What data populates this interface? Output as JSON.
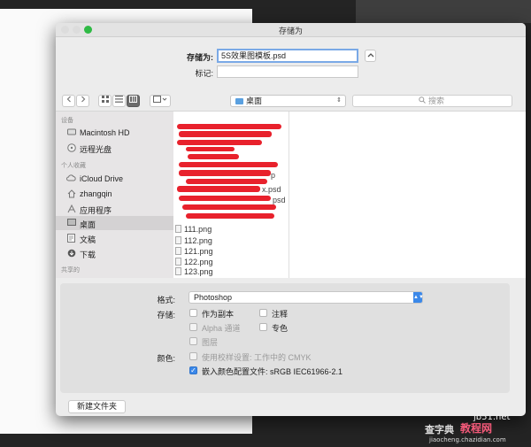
{
  "window": {
    "title": "存储为",
    "colors": {
      "close": "#dcdcdc",
      "min": "#dcdcdc",
      "zoom": "#2fba45",
      "accent": "#3b88e9",
      "redaction": "#e8212c"
    }
  },
  "header": {
    "save_as_label": "存储为:",
    "save_as_value": "5S效果图模板.psd",
    "tags_label": "标记:",
    "tags_value": "",
    "expand_icon": "chevron-up-icon"
  },
  "toolbar": {
    "back_icon": "chevron-left-icon",
    "forward_icon": "chevron-right-icon",
    "view_icons": [
      "icon-view-icon",
      "list-view-icon",
      "column-view-icon",
      "gallery-view-icon"
    ],
    "location": "桌面",
    "search_placeholder": "搜索"
  },
  "sidebar": {
    "sections": [
      {
        "heading": "设备",
        "items": [
          {
            "label": "Macintosh HD",
            "icon": "hard-drive-icon"
          },
          {
            "label": "远程光盘",
            "icon": "disc-icon"
          }
        ]
      },
      {
        "heading": "个人收藏",
        "items": [
          {
            "label": "iCloud Drive",
            "icon": "cloud-icon"
          },
          {
            "label": "zhangqin",
            "icon": "home-icon"
          },
          {
            "label": "应用程序",
            "icon": "applications-icon"
          },
          {
            "label": "桌面",
            "icon": "desktop-icon",
            "selected": true
          },
          {
            "label": "文稿",
            "icon": "document-icon"
          },
          {
            "label": "下载",
            "icon": "download-icon"
          }
        ]
      },
      {
        "heading": "共享的",
        "items": []
      }
    ]
  },
  "files": {
    "partial": [
      "p",
      "x.psd",
      "psd"
    ],
    "visible": [
      "111.png",
      "112.png",
      "121.png",
      "122.png",
      "123.png"
    ]
  },
  "options": {
    "format_label": "格式:",
    "format_value": "Photoshop",
    "save_label": "存储:",
    "color_label": "颜色:",
    "save_options": [
      {
        "label": "作为副本",
        "checked": false,
        "disabled": false
      },
      {
        "label": "注释",
        "checked": false,
        "disabled": false
      },
      {
        "label": "Alpha 通道",
        "checked": false,
        "disabled": true
      },
      {
        "label": "专色",
        "checked": false,
        "disabled": false
      },
      {
        "label": "图层",
        "checked": false,
        "disabled": true
      }
    ],
    "color_options": [
      {
        "label": "使用校样设置: 工作中的 CMYK",
        "checked": false,
        "disabled": true
      },
      {
        "label": "嵌入颜色配置文件: sRGB IEC61966-2.1",
        "checked": true,
        "disabled": false
      }
    ]
  },
  "footer": {
    "new_folder_label": "新建文件夹"
  },
  "watermark": {
    "left": "查字典",
    "right": "教程网",
    "site": "jb51.net",
    "url": "jiaocheng.chazidian.com"
  }
}
